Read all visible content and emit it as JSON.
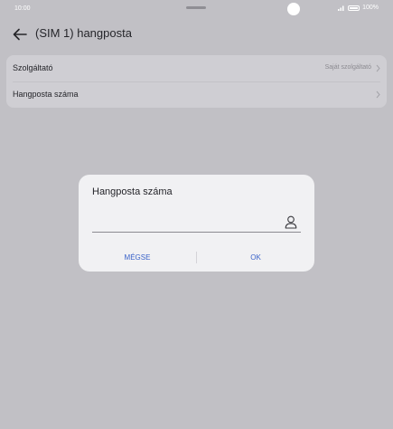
{
  "status_bar": {
    "time": "10:00",
    "battery": "100%"
  },
  "header": {
    "title": "(SIM 1) hangposta"
  },
  "settings": {
    "rows": [
      {
        "label": "Szolgáltató",
        "value": "Saját szolgáltató"
      },
      {
        "label": "Hangposta száma",
        "value": ""
      }
    ]
  },
  "dialog": {
    "title": "Hangposta száma",
    "input_value": "",
    "cancel_label": "MÉGSE",
    "ok_label": "OK"
  },
  "colors": {
    "background": "#c1c0c5",
    "accent": "#3a63c9",
    "dialog_bg": "#f1f1f3"
  },
  "icons": [
    "back-arrow-icon",
    "signal-icon",
    "battery-icon",
    "chevron-right-icon",
    "contact-icon"
  ]
}
